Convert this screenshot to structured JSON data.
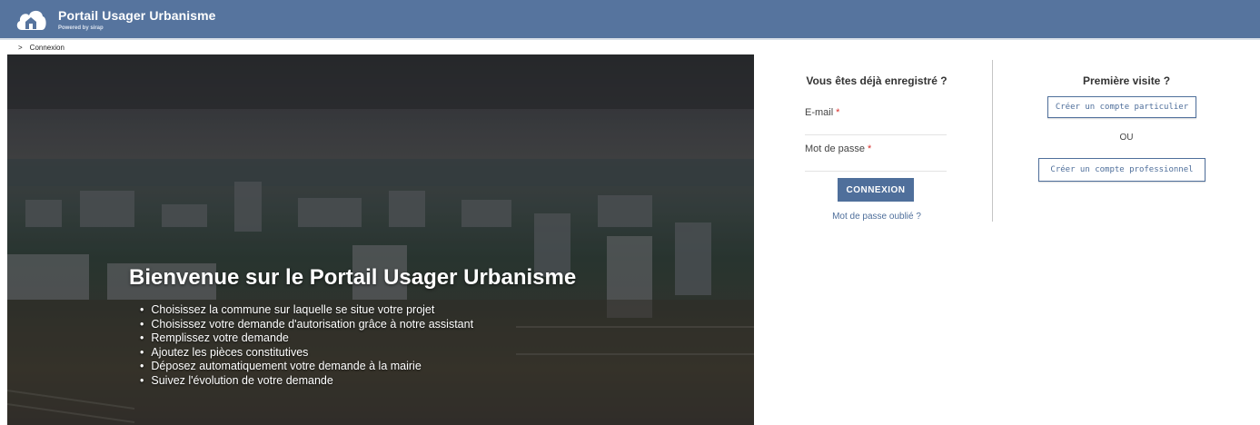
{
  "header": {
    "title": "Portail Usager Urbanisme",
    "subtitle": "Powered by sirap",
    "logo_icon": "cloud-house-icon",
    "bg_color": "#56749e"
  },
  "breadcrumb": {
    "separator": ">",
    "current": "Connexion"
  },
  "hero": {
    "title": "Bienvenue sur le Portail Usager Urbanisme",
    "items": [
      "Choisissez la commune sur laquelle se situe votre projet",
      "Choisissez votre demande d'autorisation grâce à notre assistant",
      "Remplissez votre demande",
      "Ajoutez les pièces constitutives",
      "Déposez automatiquement votre demande à la mairie",
      "Suivez l'évolution de votre demande"
    ]
  },
  "login": {
    "title": "Vous êtes déjà enregistré ?",
    "email_label": "E-mail",
    "password_label": "Mot de passe",
    "required_mark": "*",
    "button_label": "CONNEXION",
    "forgot_label": "Mot de passe oublié ?"
  },
  "register": {
    "title": "Première visite ?",
    "individual_button": "Créer un compte particulier",
    "or_label": "OU",
    "professional_button": "Créer un compte professionnel"
  },
  "colors": {
    "accent": "#4f6f9b",
    "required": "#d9302c"
  }
}
